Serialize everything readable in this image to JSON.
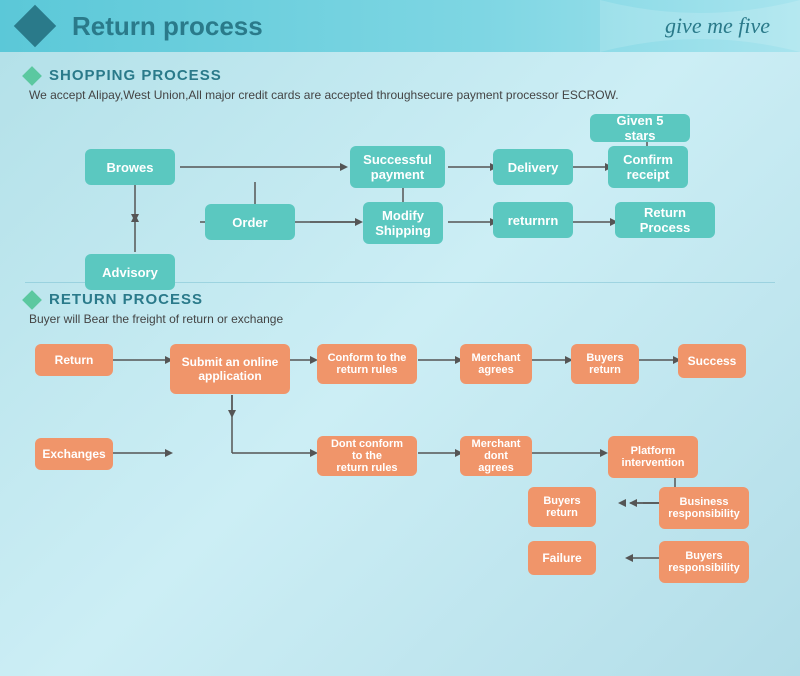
{
  "header": {
    "title": "Return process",
    "logo": "give me five"
  },
  "shopping_section": {
    "title": "SHOPPING PROCESS",
    "subtitle": "We accept Alipay,West Union,All major credit cards are accepted throughsecure payment processor ESCROW.",
    "boxes": [
      {
        "id": "browes",
        "label": "Browes"
      },
      {
        "id": "order",
        "label": "Order"
      },
      {
        "id": "advisory",
        "label": "Advisory"
      },
      {
        "id": "successful_payment",
        "label": "Successful\npayment"
      },
      {
        "id": "modify_shipping",
        "label": "Modify\nShipping"
      },
      {
        "id": "delivery",
        "label": "Delivery"
      },
      {
        "id": "confirm_receipt",
        "label": "Confirm\nreceipt"
      },
      {
        "id": "given_5_stars",
        "label": "Given 5 stars"
      },
      {
        "id": "returnm",
        "label": "returnrn"
      },
      {
        "id": "return_process",
        "label": "Return Process"
      }
    ]
  },
  "return_section": {
    "title": "RETURN PROCESS",
    "subtitle": "Buyer will Bear the freight of return or exchange",
    "boxes": [
      {
        "id": "return",
        "label": "Return"
      },
      {
        "id": "exchanges",
        "label": "Exchanges"
      },
      {
        "id": "submit_online",
        "label": "Submit an online\napplication"
      },
      {
        "id": "conform_rules",
        "label": "Conform to the\nreturn rules"
      },
      {
        "id": "merchant_agrees",
        "label": "Merchant\nagrees"
      },
      {
        "id": "buyers_return1",
        "label": "Buyers\nreturn"
      },
      {
        "id": "success",
        "label": "Success"
      },
      {
        "id": "dont_conform",
        "label": "Dont conform to the\nreturn rules"
      },
      {
        "id": "merchant_dont",
        "label": "Merchant\ndont agrees"
      },
      {
        "id": "platform_intervention",
        "label": "Platform\nintervention"
      },
      {
        "id": "buyers_return2",
        "label": "Buyers\nreturn"
      },
      {
        "id": "business_responsibility",
        "label": "Business\nresponsibility"
      },
      {
        "id": "failure",
        "label": "Failure"
      },
      {
        "id": "buyers_responsibility",
        "label": "Buyers\nresponsibility"
      }
    ]
  }
}
